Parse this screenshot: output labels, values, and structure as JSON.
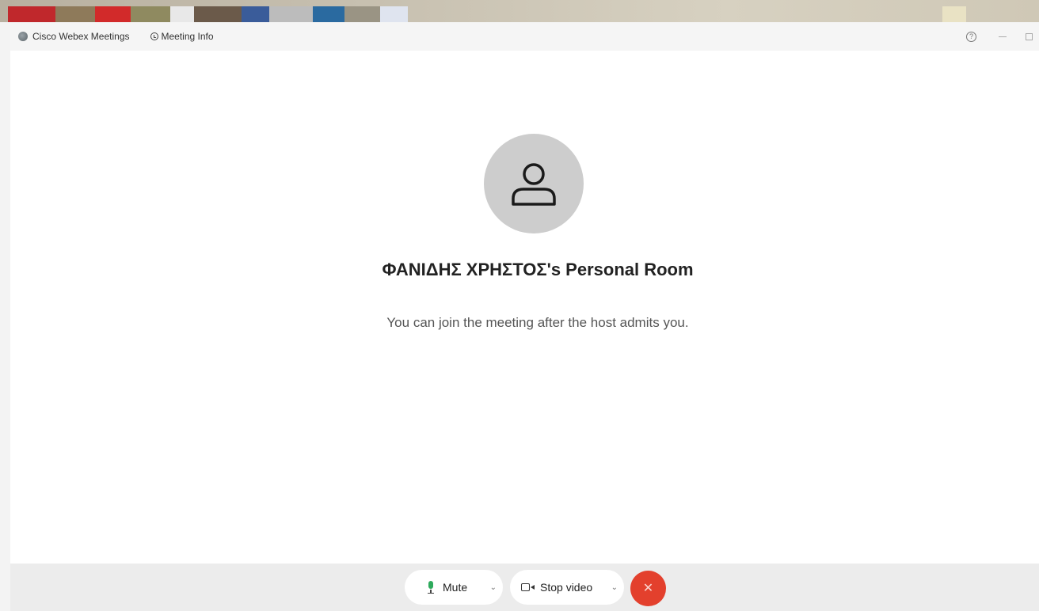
{
  "window": {
    "app_title": "Cisco Webex Meetings",
    "meeting_info_label": "Meeting Info"
  },
  "main": {
    "room_title": "ΦΑΝΙΔΗΣ ΧΡΗΣΤΟΣ's Personal Room",
    "lobby_message": "You can join the meeting after the host admits you."
  },
  "controls": {
    "mute_label": "Mute",
    "stop_video_label": "Stop video",
    "leave_glyph": "✕"
  },
  "icons": {
    "app_logo": "webex-logo-icon",
    "info": "info-icon",
    "help": "help-icon",
    "avatar": "person-icon",
    "mic": "microphone-icon",
    "camera": "camera-icon",
    "chevron": "chevron-down-icon"
  },
  "colors": {
    "leave_button": "#e3402d",
    "mic_active": "#2eaa5c",
    "avatar_bg": "#cdcdcd"
  }
}
